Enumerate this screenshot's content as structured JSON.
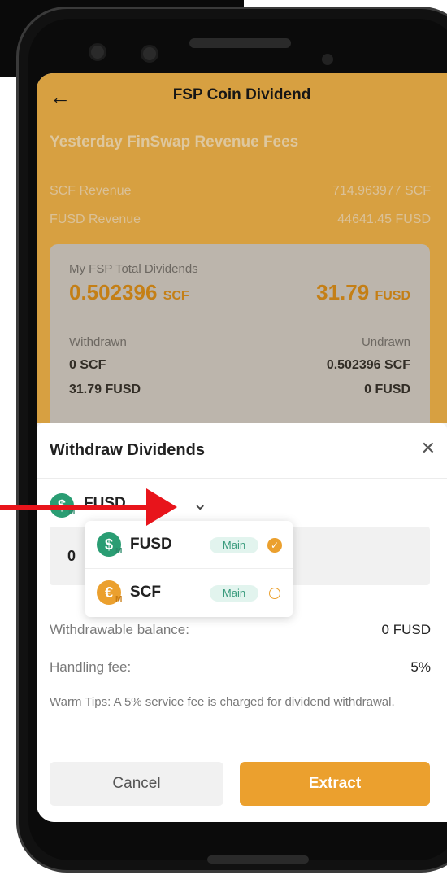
{
  "header": {
    "title": "FSP Coin Dividend",
    "section_title": "Yesterday FinSwap Revenue Fees",
    "scf_revenue_label": "SCF Revenue",
    "scf_revenue_value": "714.963977 SCF",
    "fusd_revenue_label": "FUSD Revenue",
    "fusd_revenue_value": "44641.45 FUSD"
  },
  "dividends_card": {
    "title": "My FSP Total Dividends",
    "scf_amount": "0.502396",
    "scf_unit": "SCF",
    "fusd_amount": "31.79",
    "fusd_unit": "FUSD",
    "withdrawn_label": "Withdrawn",
    "undrawn_label": "Undrawn",
    "withdrawn_scf": "0 SCF",
    "withdrawn_fusd": "31.79 FUSD",
    "undrawn_scf": "0.502396 SCF",
    "undrawn_fusd": "0 FUSD"
  },
  "sheet": {
    "title": "Withdraw Dividends",
    "selected_coin": "FUSD",
    "amount_value": "0",
    "withdrawable_label": "Withdrawable balance:",
    "withdrawable_value": "0 FUSD",
    "fee_label": "Handling fee:",
    "fee_value": "5%",
    "tips": "Warm Tips: A 5% service fee is charged for dividend withdrawal.",
    "cancel_label": "Cancel",
    "extract_label": "Extract"
  },
  "dropdown": {
    "items": [
      {
        "name": "FUSD",
        "badge": "Main",
        "selected": true,
        "icon_glyph": "$",
        "icon_color": "#2a9d73"
      },
      {
        "name": "SCF",
        "badge": "Main",
        "selected": false,
        "icon_glyph": "€",
        "icon_color": "#eba02e"
      }
    ],
    "coin_sub_letter": "M"
  },
  "colors": {
    "accent": "#eba02e",
    "header_bg": "#f5b74a",
    "annotation_arrow": "#e8141b"
  }
}
